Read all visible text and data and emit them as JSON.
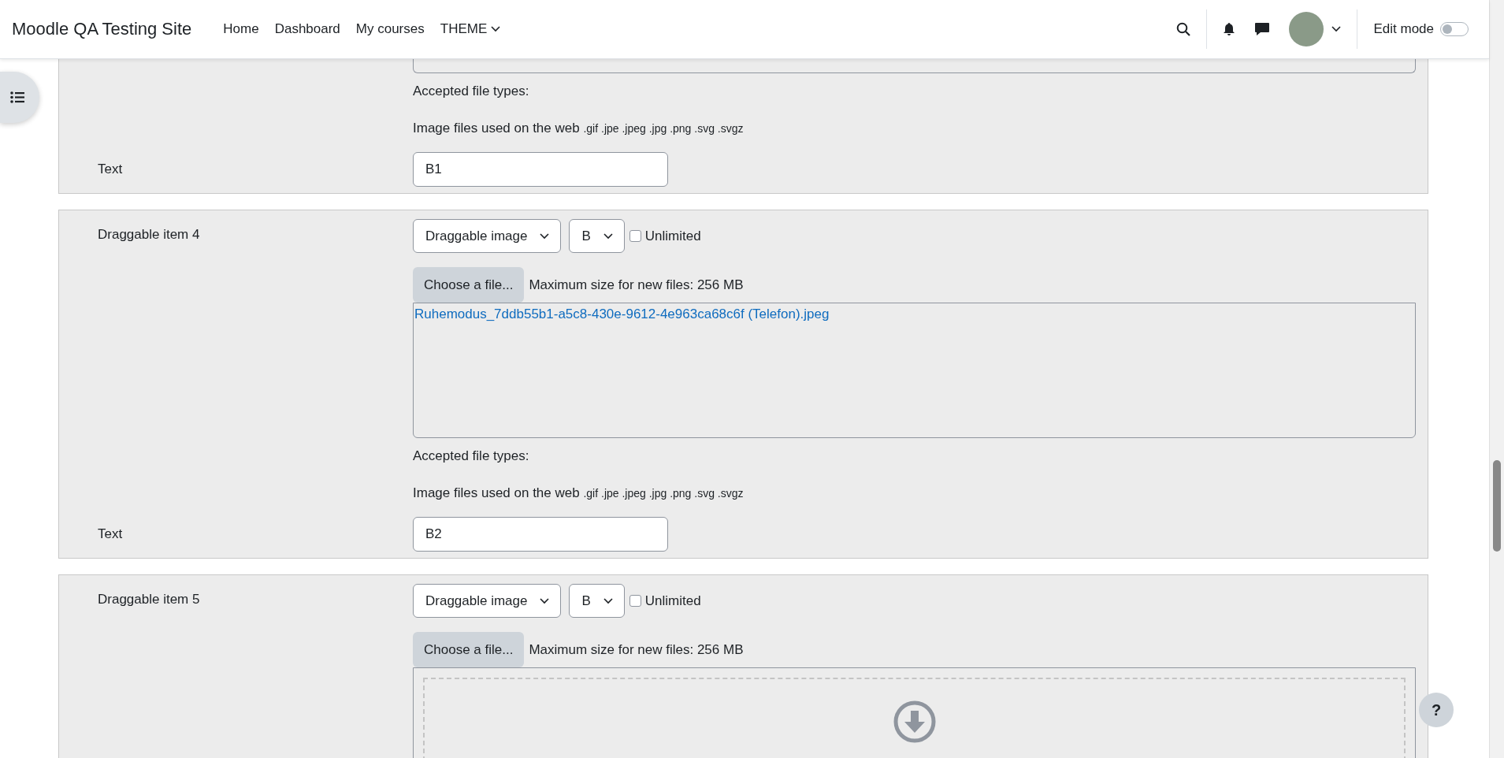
{
  "header": {
    "site_name": "Moodle QA Testing Site",
    "nav": [
      {
        "label": "Home",
        "dropdown": false
      },
      {
        "label": "Dashboard",
        "dropdown": false
      },
      {
        "label": "My courses",
        "dropdown": false
      },
      {
        "label": "THEME",
        "dropdown": true
      }
    ],
    "edit_mode": {
      "label": "Edit mode",
      "on": false
    }
  },
  "sections": [
    {
      "kind": "tail",
      "accepted_label": "Accepted file types:",
      "accepted_name": "Image files used on the web",
      "accepted_ext": ".gif .jpe .jpeg .jpg .png .svg .svgz",
      "text_label": "Text",
      "text_value": "B1"
    },
    {
      "kind": "full",
      "label": "Draggable item 4",
      "type_select": "Draggable image",
      "group_select": "B",
      "unlimited": {
        "label": "Unlimited",
        "checked": false
      },
      "choose_button": "Choose a file...",
      "max_size": "Maximum size for new files: 256 MB",
      "file_area": {
        "kind": "files",
        "files": [
          "Ruhemodus_7ddb55b1-a5c8-430e-9612-4e963ca68c6f (Telefon).jpeg"
        ]
      },
      "accepted_label": "Accepted file types:",
      "accepted_name": "Image files used on the web",
      "accepted_ext": ".gif .jpe .jpeg .jpg .png .svg .svgz",
      "text_label": "Text",
      "text_value": "B2"
    },
    {
      "kind": "head",
      "label": "Draggable item 5",
      "type_select": "Draggable image",
      "group_select": "B",
      "unlimited": {
        "label": "Unlimited",
        "checked": false
      },
      "choose_button": "Choose a file...",
      "max_size": "Maximum size for new files: 256 MB",
      "file_area": {
        "kind": "dropzone"
      }
    }
  ],
  "help_button": "?"
}
